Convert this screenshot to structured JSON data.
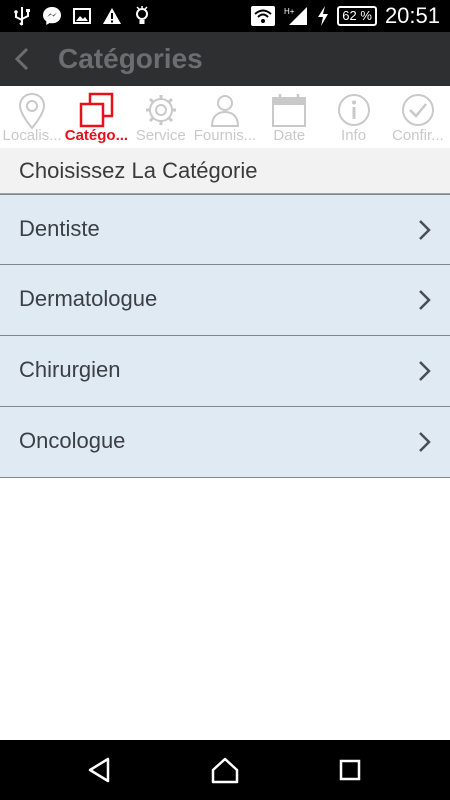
{
  "status_bar": {
    "icons": [
      "usb-icon",
      "messenger-icon",
      "image-icon",
      "warning-icon",
      "bulb-icon"
    ],
    "battery": "62 %",
    "time": "20:51",
    "network": "H+"
  },
  "app_bar": {
    "back_icon": "chevron-left-icon",
    "title": "Catégories"
  },
  "steps": [
    {
      "label": "Localis...",
      "icon": "location-pin-icon",
      "active": false
    },
    {
      "label": "Catégo...",
      "icon": "categories-squares-icon",
      "active": true
    },
    {
      "label": "Service",
      "icon": "gear-icon",
      "active": false
    },
    {
      "label": "Fournis...",
      "icon": "person-icon",
      "active": false
    },
    {
      "label": "Date",
      "icon": "calendar-icon",
      "active": false
    },
    {
      "label": "Info",
      "icon": "info-icon",
      "active": false
    },
    {
      "label": "Confir...",
      "icon": "checkmark-circle-icon",
      "active": false
    }
  ],
  "colors": {
    "active_step": "#e8101a",
    "inactive_step": "#c9c9c9",
    "app_bar": "#2d2f31",
    "list_item_bg": "#dfeaf2"
  },
  "section": {
    "title": "Choisissez La Catégorie"
  },
  "categories": [
    {
      "label": "Dentiste"
    },
    {
      "label": "Dermatologue"
    },
    {
      "label": "Chirurgien"
    },
    {
      "label": "Oncologue"
    }
  ],
  "nav_bar": {
    "buttons": [
      "back-triangle-icon",
      "home-icon",
      "recents-square-icon"
    ]
  }
}
